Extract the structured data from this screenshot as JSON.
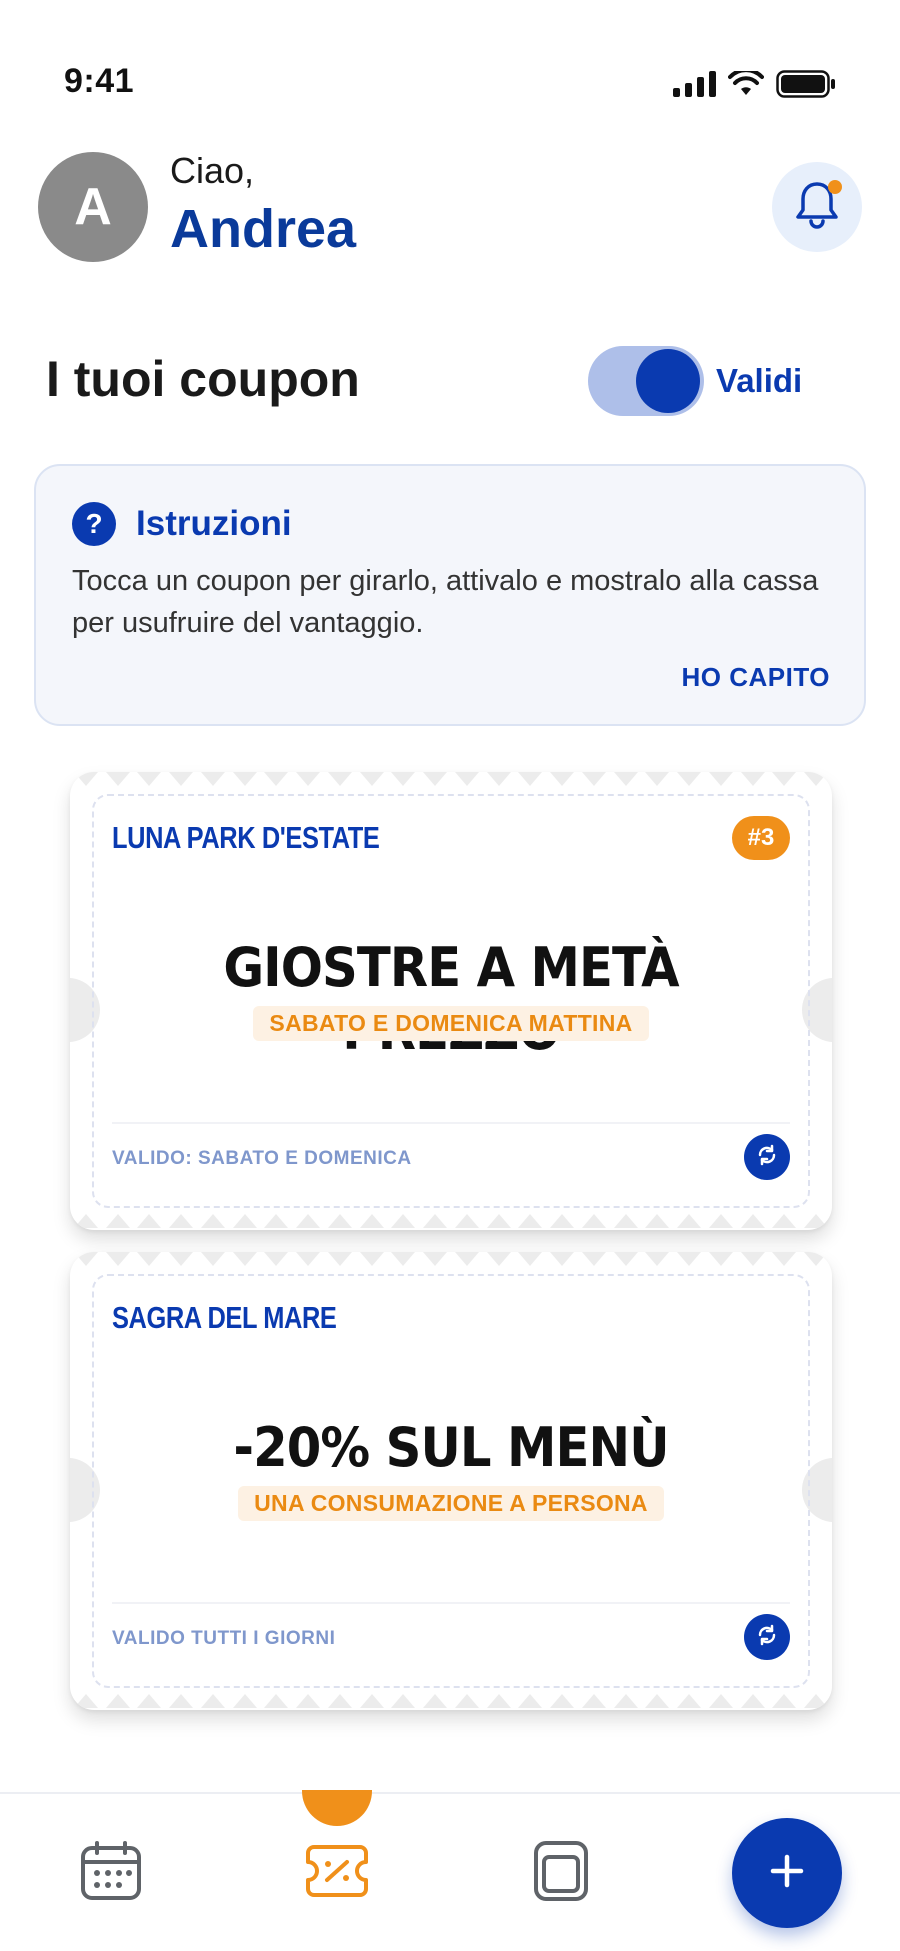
{
  "status_bar": {
    "time": "9:41"
  },
  "header": {
    "avatar_initial": "A",
    "greeting": "Ciao,",
    "user_name": "Andrea"
  },
  "coupons_section": {
    "title": "I tuoi coupon",
    "toggle_label": "Validi",
    "toggle_on": true
  },
  "instructions": {
    "icon": "?",
    "title": "Istruzioni",
    "text": "Tocca un coupon per girarlo, attivalo e mostralo alla cassa per usufruire del vantaggio.",
    "button": "HO CAPITO"
  },
  "coupons": [
    {
      "brand": "LUNA PARK D'ESTATE",
      "badge": "#3",
      "headline": "GIOSTRE A METÀ PREZZO",
      "subtitle": "SABATO E DOMENICA MATTINA",
      "validity": "VALIDO: SABATO E DOMENICA"
    },
    {
      "brand": "SAGRA DEL MARE",
      "headline": "-20% SUL MENÙ",
      "subtitle": "UNA CONSUMAZIONE A PERSONA",
      "validity": "VALIDO TUTTI I GIORNI"
    }
  ],
  "bottom_nav": {
    "items": [
      {
        "icon": "calendar-icon"
      },
      {
        "icon": "coupon-icon",
        "active": true
      },
      {
        "icon": "cards-icon"
      }
    ],
    "fab_label": "+"
  },
  "colors": {
    "primary": "#0a3ab0",
    "accent": "#f0901a",
    "avatar": "#8a8a8a"
  }
}
